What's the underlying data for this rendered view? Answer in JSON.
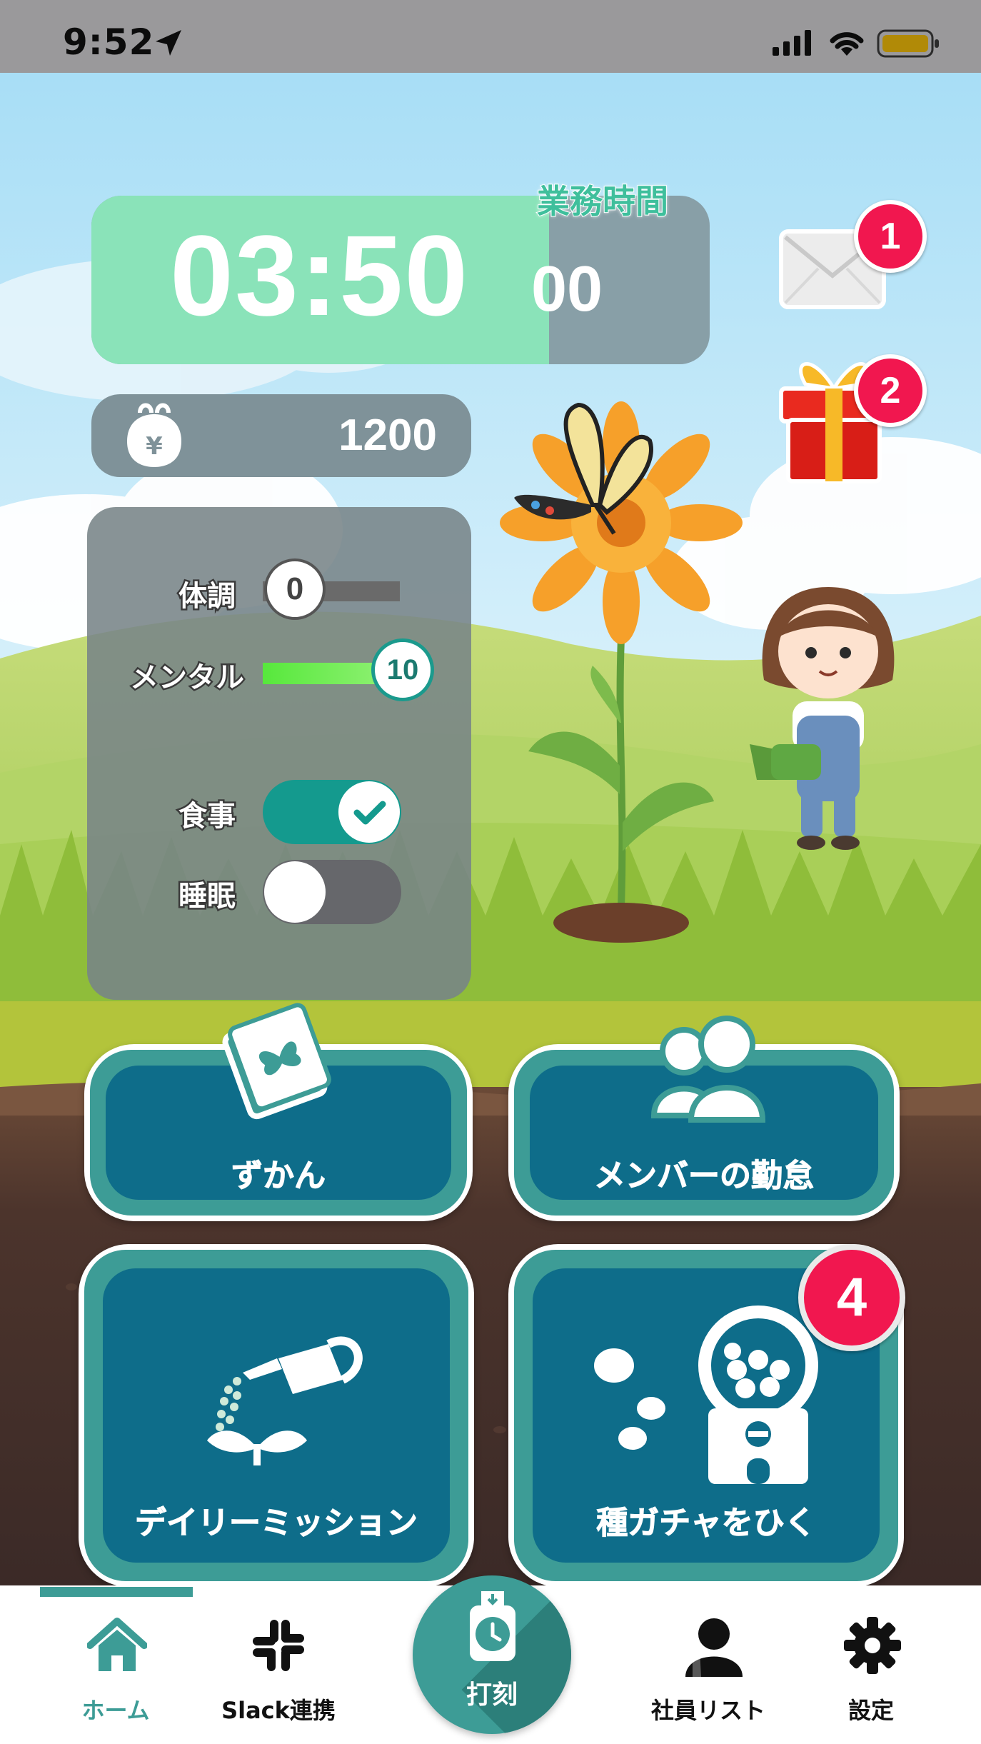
{
  "status_bar": {
    "time": "9:52"
  },
  "timer": {
    "main": "03:50",
    "seconds": "00",
    "label": "業務時間",
    "progress": 0.74
  },
  "wallet": {
    "amount": "1200",
    "icon": "coin-purse-icon"
  },
  "conditions": {
    "physical": {
      "label": "体調",
      "value": "0",
      "level": 0
    },
    "mental": {
      "label": "メンタル",
      "value": "10",
      "level": 1
    },
    "meal": {
      "label": "食事",
      "on": true
    },
    "sleep": {
      "label": "睡眠",
      "on": false
    }
  },
  "side": {
    "mail_badge": "1",
    "gift_badge": "2"
  },
  "menu": {
    "encyclopedia": "ずかん",
    "attendance": "メンバーの勤怠",
    "daily_mission": "デイリーミッション",
    "gacha": "種ガチャをひく",
    "gacha_badge": "4"
  },
  "nav": {
    "home": "ホーム",
    "slack": "Slack連携",
    "punch": "打刻",
    "employees": "社員リスト",
    "settings": "設定"
  },
  "colors": {
    "accent": "#3d9c96",
    "tile_inner": "#0e6d8a",
    "badge": "#f1174f",
    "timer_fill": "#8ae3b9"
  }
}
